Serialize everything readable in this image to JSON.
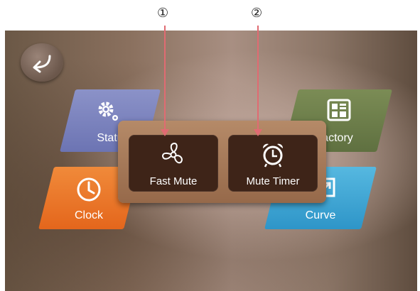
{
  "callouts": [
    "①",
    "②"
  ],
  "tiles": {
    "status": {
      "label": "Statu",
      "icon": "gear-icon"
    },
    "clock": {
      "label": "Clock",
      "icon": "clock-icon"
    },
    "factory": {
      "label": "actory",
      "icon": "factory-grid-icon"
    },
    "curve": {
      "label": "Curve",
      "icon": "curve-arrow-icon"
    }
  },
  "popup": {
    "fast_mute": {
      "label": "Fast Mute",
      "icon": "fan-icon"
    },
    "mute_timer": {
      "label": "Mute Timer",
      "icon": "alarm-clock-icon"
    }
  },
  "back_button": {
    "icon": "back-arrow-icon"
  },
  "colors": {
    "status_tile": "#7b82bf",
    "clock_tile": "#e9732a",
    "factory_tile": "#6d7e4b",
    "curve_tile": "#3fa6d4",
    "popup_bg": "#a6795a",
    "popup_button": "#3e2418",
    "leader_line": "#e06b72"
  }
}
